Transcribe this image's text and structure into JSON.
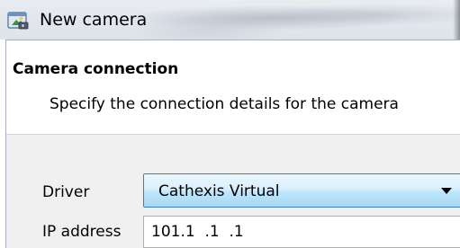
{
  "window": {
    "title": "New camera",
    "icon": "new-camera-app-icon"
  },
  "header": {
    "title": "Camera connection",
    "subtitle": "Specify the connection details for the camera"
  },
  "form": {
    "driver": {
      "label": "Driver",
      "value": "Cathexis Virtual",
      "icon": "chevron-down-icon"
    },
    "ip_address": {
      "label": "IP address",
      "value": "101.1  .1  .1"
    }
  },
  "colors": {
    "combo_border": "#3c7fb1",
    "combo_fill": "#bee6fd",
    "form_background": "#f0f0f0"
  }
}
